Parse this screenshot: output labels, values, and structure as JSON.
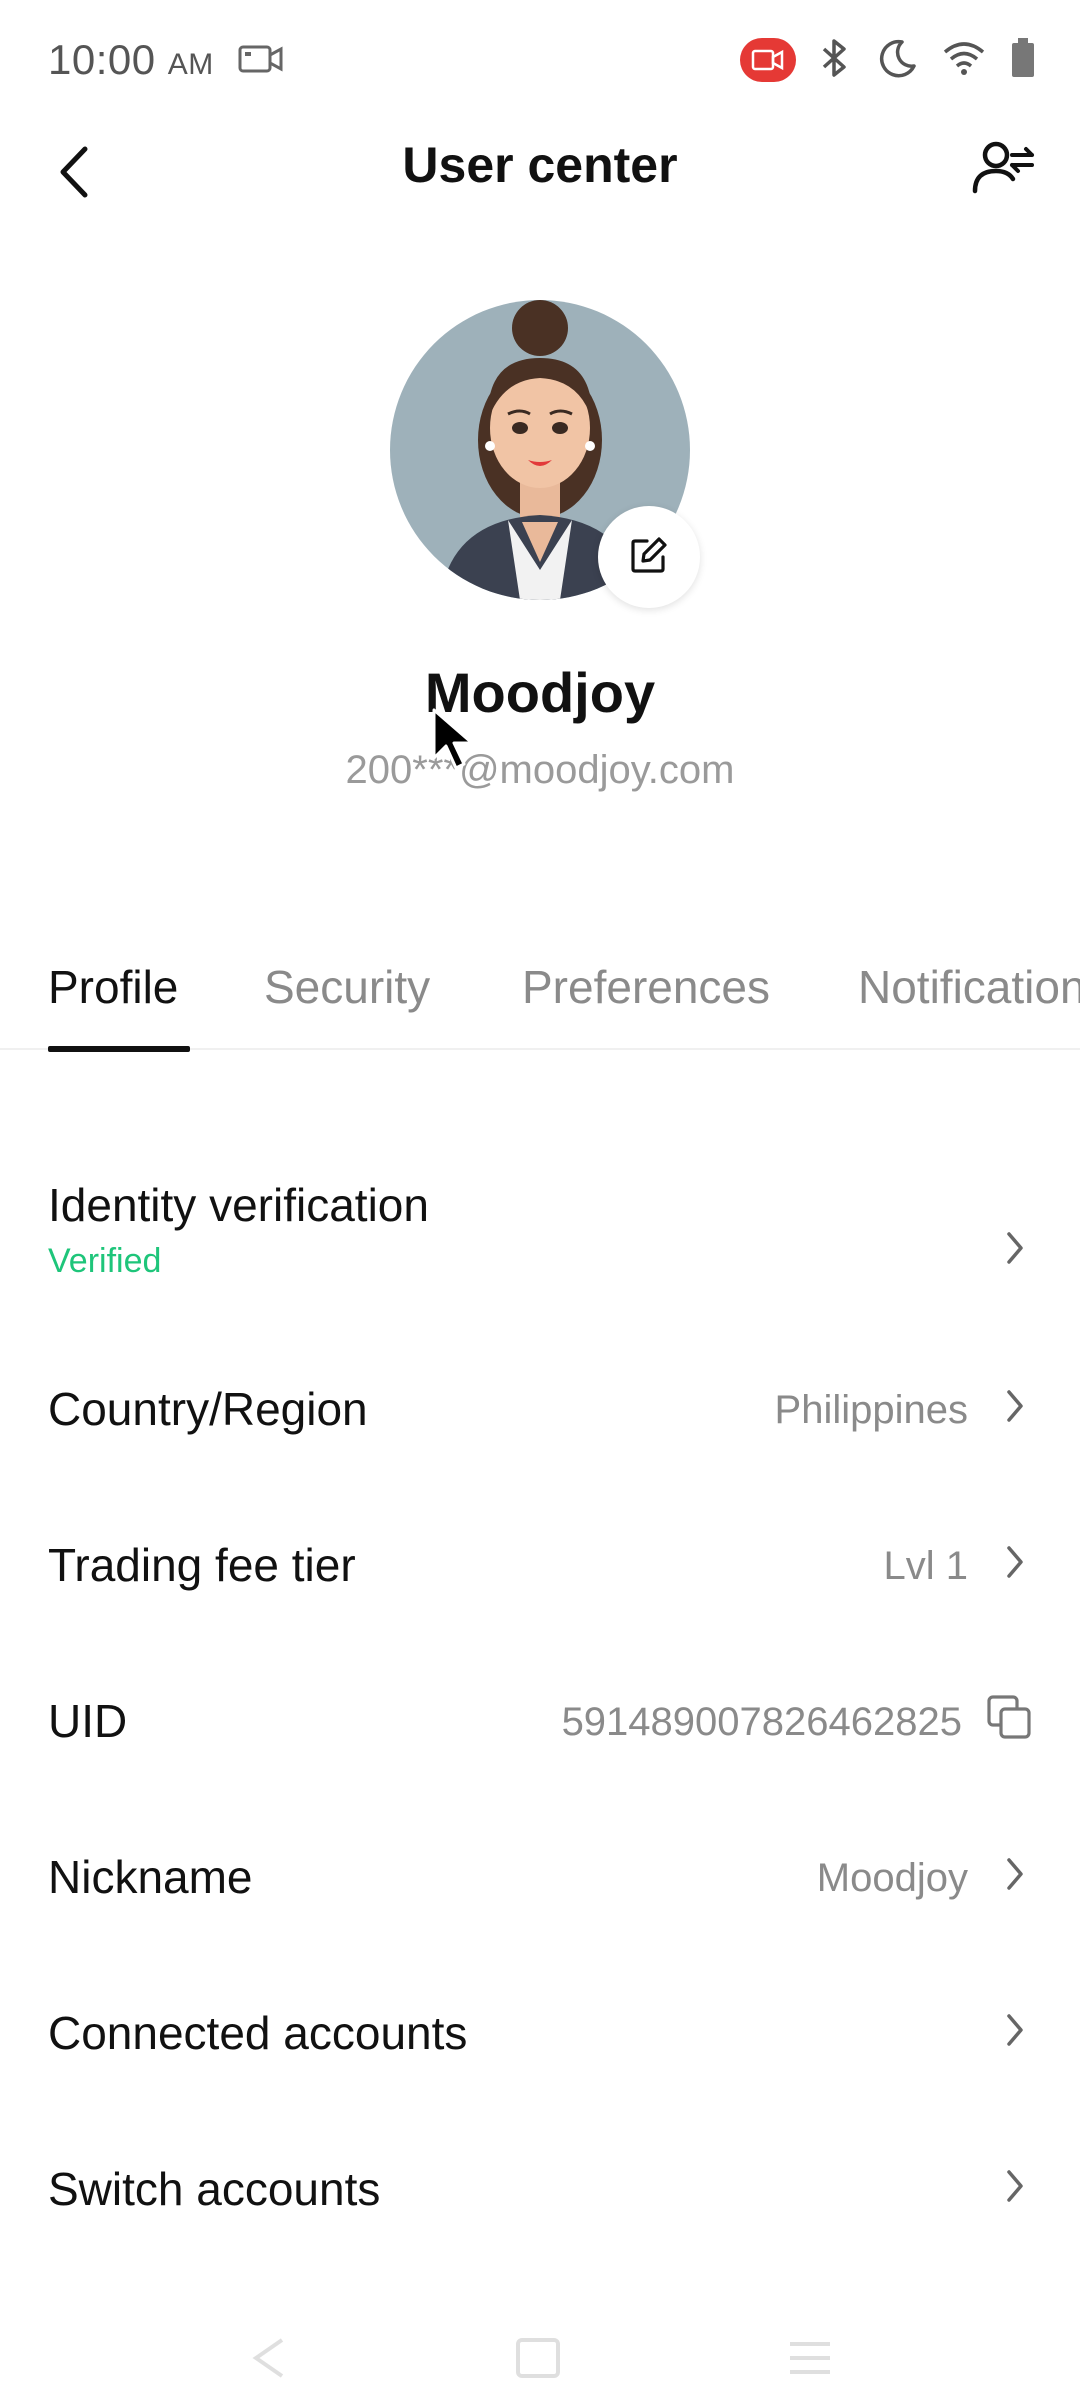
{
  "status_bar": {
    "time": "10:00",
    "ampm": "AM"
  },
  "header": {
    "title": "User center"
  },
  "profile": {
    "display_name": "Moodjoy",
    "email": "200***@moodjoy.com"
  },
  "tabs": [
    {
      "label": "Profile",
      "active": true
    },
    {
      "label": "Security",
      "active": false
    },
    {
      "label": "Preferences",
      "active": false
    },
    {
      "label": "Notifications",
      "active": false
    }
  ],
  "rows": {
    "identity": {
      "label": "Identity verification",
      "status": "Verified"
    },
    "country": {
      "label": "Country/Region",
      "value": "Philippines"
    },
    "fee_tier": {
      "label": "Trading fee tier",
      "value": "Lvl 1"
    },
    "uid": {
      "label": "UID",
      "value": "591489007826462825"
    },
    "nickname": {
      "label": "Nickname",
      "value": "Moodjoy"
    },
    "connected": {
      "label": "Connected accounts"
    },
    "switch": {
      "label": "Switch accounts"
    }
  },
  "colors": {
    "verified": "#1ec57a",
    "recording": "#e53935"
  },
  "icons": [
    "video-icon",
    "screen-record-icon",
    "bluetooth-icon",
    "moon-icon",
    "wifi-icon",
    "battery-icon",
    "back-icon",
    "switch-user-icon",
    "edit-icon",
    "chevron-right-icon",
    "copy-icon"
  ]
}
